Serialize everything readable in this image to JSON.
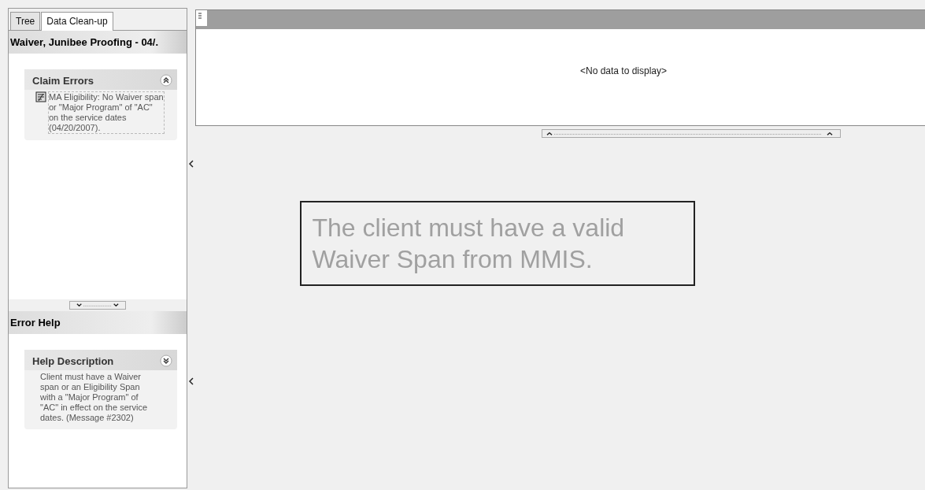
{
  "tabs": [
    {
      "label": "Tree",
      "selected": false
    },
    {
      "label": "Data Clean-up",
      "selected": true
    }
  ],
  "record_title": "Waiver, Junibee Proofing - 04/.",
  "claim_errors": {
    "title": "Claim Errors",
    "messages": [
      "MA Eligibility:  No Waiver span or \"Major Program\" of \"AC\" on the service dates (04/20/2007)."
    ]
  },
  "error_help": {
    "title": "Error Help",
    "group_title": "Help Description",
    "description": "Client must have a Waiver span or an Eligibility Span with a \"Major Program\" of \"AC\" in effect on the service dates. (Message #2302)"
  },
  "grid": {
    "empty_text": "<No data to display>"
  },
  "notice": "The client must have a valid Waiver Span from MMIS."
}
